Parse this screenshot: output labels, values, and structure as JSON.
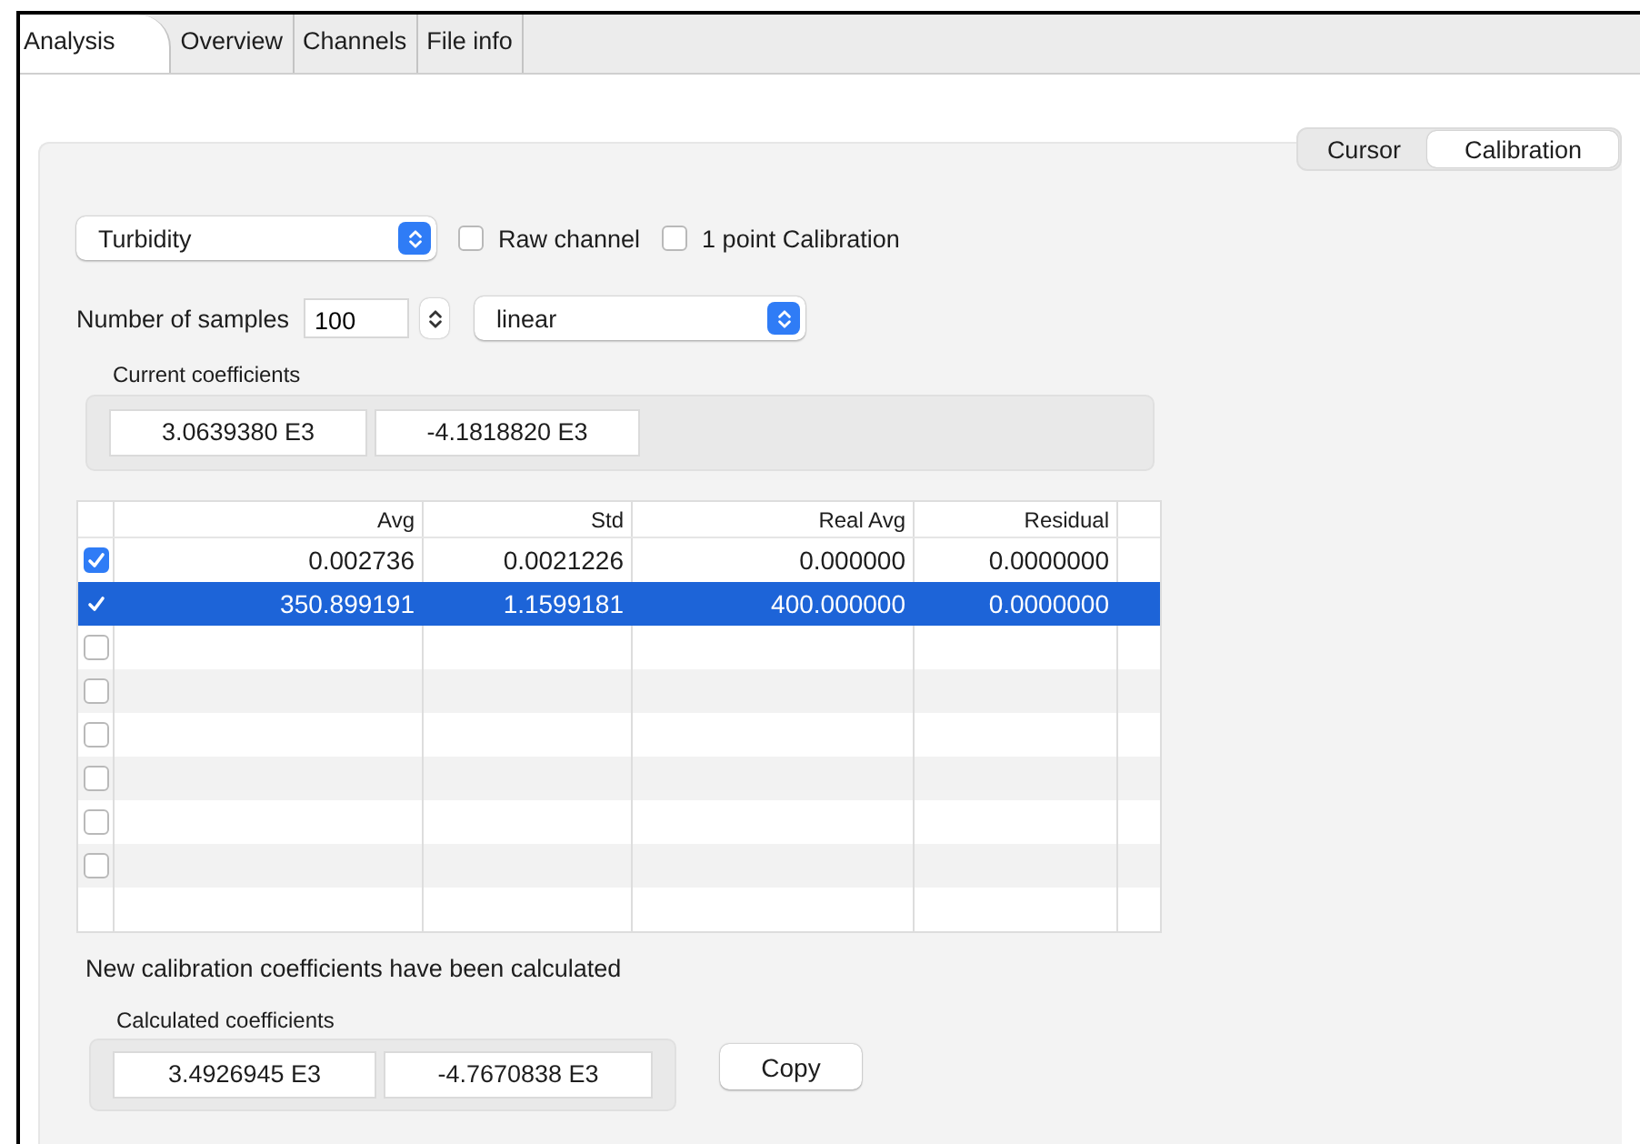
{
  "tabs": [
    {
      "label": "Analysis",
      "selected": true
    },
    {
      "label": "Overview",
      "selected": false
    },
    {
      "label": "Channels",
      "selected": false
    },
    {
      "label": "File info",
      "selected": false
    }
  ],
  "segments": [
    {
      "label": "Cursor",
      "selected": false
    },
    {
      "label": "Calibration",
      "selected": true
    }
  ],
  "channel_select": {
    "value": "Turbidity"
  },
  "options": [
    {
      "label": "Raw channel",
      "checked": false
    },
    {
      "label": "1 point Calibration",
      "checked": false
    }
  ],
  "samples": {
    "label": "Number of samples",
    "value": "100"
  },
  "fit_select": {
    "value": "linear"
  },
  "current_coefficients": {
    "title": "Current coefficients",
    "values": [
      "3.0639380 E3",
      "-4.1818820 E3"
    ]
  },
  "table": {
    "columns": [
      "Avg",
      "Std",
      "Real Avg",
      "Residual"
    ],
    "rows": [
      {
        "kind": "check",
        "checked": true,
        "selected": false,
        "cells": [
          "0.002736",
          "0.0021226",
          "0.000000",
          "0.0000000"
        ]
      },
      {
        "kind": "check",
        "checked": true,
        "selected": true,
        "cells": [
          "350.899191",
          "1.1599181",
          "400.000000",
          "0.0000000"
        ]
      },
      {
        "kind": "check",
        "checked": false,
        "selected": false
      },
      {
        "kind": "check",
        "checked": false,
        "selected": false
      },
      {
        "kind": "check",
        "checked": false,
        "selected": false
      },
      {
        "kind": "check",
        "checked": false,
        "selected": false
      },
      {
        "kind": "check",
        "checked": false,
        "selected": false
      },
      {
        "kind": "check",
        "checked": false,
        "selected": false
      },
      {
        "kind": "blank",
        "selected": false
      }
    ]
  },
  "message": "New calibration coefficients have been calculated",
  "calculated_coefficients": {
    "title": "Calculated coefficients",
    "values": [
      "3.4926945 E3",
      "-4.7670838 E3"
    ]
  },
  "copy_button": "Copy"
}
